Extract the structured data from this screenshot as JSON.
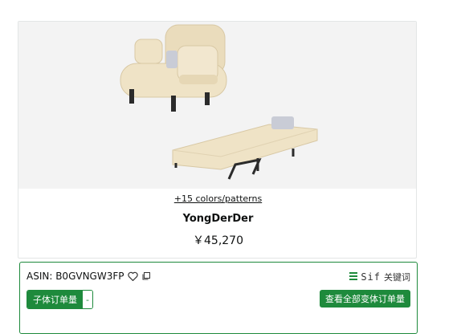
{
  "product": {
    "colors_link": "+15 colors/patterns",
    "brand": "YongDerDer",
    "price": "￥45,270"
  },
  "extension": {
    "asin_label": "ASIN: B0GVNGW3FP",
    "sif_label": "Sif",
    "keyword_label": "关键词",
    "sub_order_label": "子体订单量",
    "sub_order_value": "-",
    "all_variants_label": "查看全部变体订单量"
  },
  "colors": {
    "accent_green": "#1e8a3c",
    "image_bg": "#f3f3f3",
    "product_beige": "#efe3c6"
  },
  "icons": [
    "heart-icon",
    "copy-icon",
    "list-icon"
  ]
}
